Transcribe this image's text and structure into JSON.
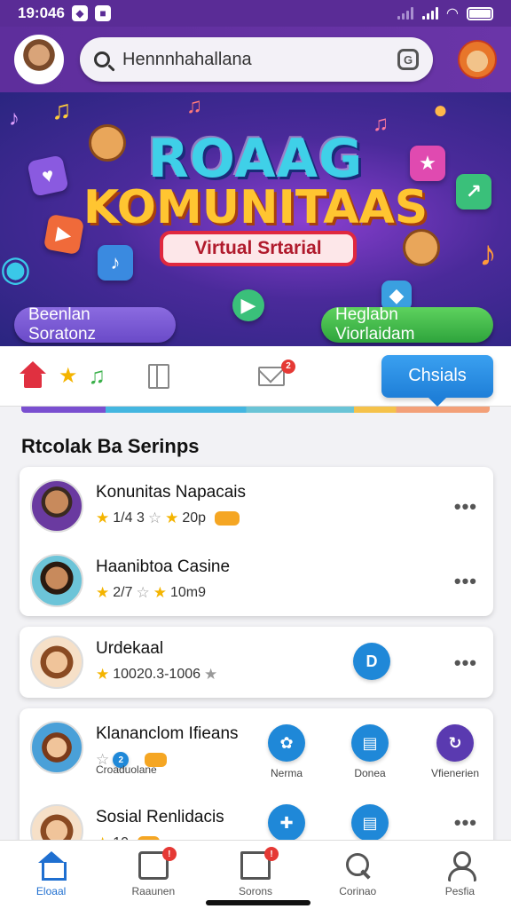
{
  "status_bar": {
    "time": "19:046"
  },
  "header": {
    "search_value": "Hennnhahallana",
    "avatar_icon": "person-avatar",
    "mascot_icon": "fox-mascot"
  },
  "banner": {
    "title_line1": "ROAAG",
    "title_line2": "KOMUNITAAS",
    "subtitle": "Virtual Srtarial",
    "left_button": "Beenlan Soratonz",
    "right_button": "Heglabn Viorlaidam"
  },
  "tabs": {
    "active_label": "Chsials",
    "mail_badge": "2"
  },
  "section": {
    "title": "Rtcolak Ba Serinps"
  },
  "rows": [
    {
      "name": "Konunitas Napacais",
      "meta": "1/4 3",
      "meta2": "20p",
      "tag": ""
    },
    {
      "name": "Haanibtoa Casine",
      "meta": "2/7",
      "meta2": "10m9"
    },
    {
      "name": "Urdekaal",
      "meta": "10020.3-1006",
      "button": "D"
    },
    {
      "name": "Klananclom Ifieans",
      "meta": "",
      "sub": "Croaduolane",
      "buttons": [
        {
          "label": "Nerma"
        },
        {
          "label": "Donea"
        },
        {
          "label": "Vfienerien"
        }
      ]
    },
    {
      "name": "Sosial Renlidacis",
      "meta": "10"
    }
  ],
  "bottom_nav": [
    {
      "label": "Eloaal",
      "icon": "home-icon"
    },
    {
      "label": "Raaunen",
      "icon": "inbox-icon"
    },
    {
      "label": "Sorons",
      "icon": "stack-icon"
    },
    {
      "label": "Corinao",
      "icon": "search-icon"
    },
    {
      "label": "Pesfia",
      "icon": "person-icon"
    }
  ],
  "colors": {
    "header": "#5e2e9c",
    "active_tab": "#1f7fd8",
    "accent_orange": "#f5a623"
  }
}
